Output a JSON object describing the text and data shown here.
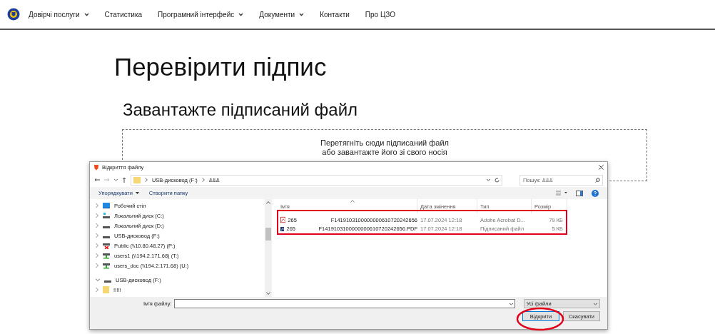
{
  "nav": [
    {
      "label": "Довірчі послуги",
      "dropdown": true
    },
    {
      "label": "Статистика",
      "dropdown": false
    },
    {
      "label": "Програмний інтерфейс",
      "dropdown": true
    },
    {
      "label": "Документи",
      "dropdown": true
    },
    {
      "label": "Контакти",
      "dropdown": false
    },
    {
      "label": "Про ЦЗО",
      "dropdown": false
    }
  ],
  "heading": "Перевірити підпис",
  "subheading": "Завантажте підписаний файл",
  "dropzone": {
    "line_1": "Перетягніть сюди підписаний файл",
    "line_2": "або завантажте його зі свого носія"
  },
  "dialog": {
    "title": "Відкриття файлу",
    "path": [
      "USB-дисковод (F:)",
      "&&&"
    ],
    "search": {
      "placeholder": "Пошук: &&&"
    },
    "toolbar": [
      "Упорядкувати",
      "Створити папку"
    ],
    "tree": [
      {
        "label": "Робочий стіл",
        "kind": "desktop",
        "expanded": false
      },
      {
        "label": "Локальний диск (C:)",
        "kind": "system-drive",
        "expanded": false
      },
      {
        "label": "Локальний диск (D:)",
        "kind": "drive",
        "expanded": false
      },
      {
        "label": "USB-дисковод (F:)",
        "kind": "drive",
        "expanded": false
      },
      {
        "label": "Public (\\\\10.80.48.27) (P:)",
        "kind": "net-offline",
        "expanded": false
      },
      {
        "label": "users1 (\\\\194.2.171.68) (T:)",
        "kind": "net",
        "expanded": false
      },
      {
        "label": "users_doc (\\\\194.2.171.68) (U:)",
        "kind": "net",
        "expanded": false
      },
      {
        "label": "USB-дисковод (F:)",
        "kind": "drive",
        "expanded": true,
        "children": [
          {
            "label": "!!!!!",
            "kind": "folder",
            "expanded": false
          }
        ]
      }
    ],
    "columns": [
      "Ім'я",
      "Дата змінення",
      "Тип",
      "Розмір"
    ],
    "files": [
      {
        "kind": "pdf",
        "name_1": "265",
        "name_2": "F1419103100000000610720242656",
        "date": "17.07.2024 12:18",
        "type": "Adobe Acrobat D...",
        "size": "79 КБ"
      },
      {
        "kind": "signed",
        "name_1": "265",
        "name_2": "F1419103100000000610720242656.PDF",
        "date": "17.07.2024 12:18",
        "type": "Підписаний файл",
        "size": "5 КБ"
      }
    ],
    "filename_label": "Ім'я файлу:",
    "filetype": "Усі файли",
    "buttons": [
      "Відкрити",
      "Скасувати"
    ]
  }
}
